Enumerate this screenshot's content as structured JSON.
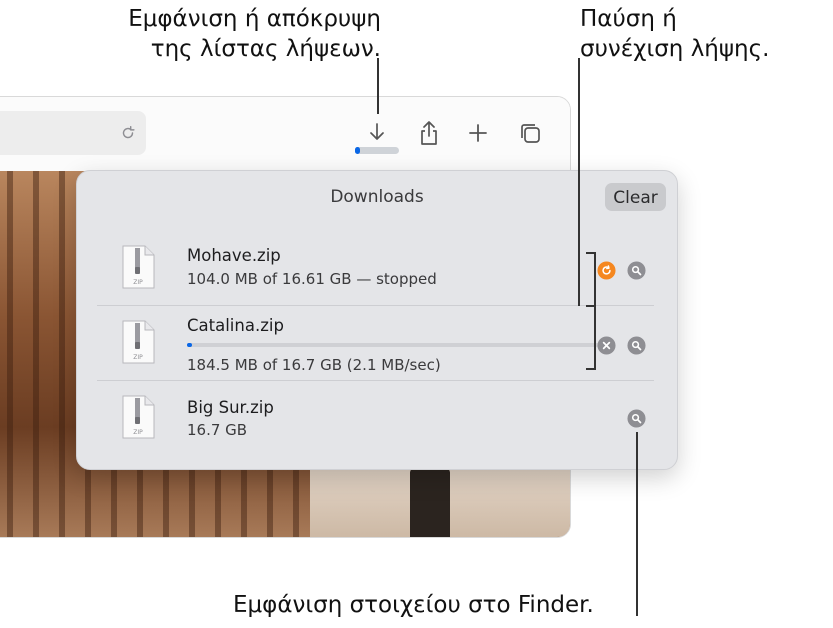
{
  "callouts": {
    "toggle_list_line1": "Εμφάνιση ή απόκρυψη",
    "toggle_list_line2": "της λίστας λήψεων.",
    "pause_resume_line1": "Παύση ή",
    "pause_resume_line2": "συνέχιση λήψης.",
    "show_in_finder": "Εμφάνιση στοιχείου στο Finder."
  },
  "toolbar": {
    "icons": [
      "reload-icon",
      "download-icon",
      "share-icon",
      "new-tab-icon",
      "tabs-overview-icon"
    ],
    "download_progress": 0.06,
    "accent": "#0a67e6"
  },
  "downloads": {
    "title": "Downloads",
    "clear_label": "Clear",
    "items": [
      {
        "name": "Mohave.zip",
        "detail": "104.0 MB of 16.61 GB — stopped",
        "icon_label": "ZIP",
        "action": "resume-icon",
        "action_color": "#f5871f",
        "progress": null
      },
      {
        "name": "Catalina.zip",
        "detail": "184.5 MB of 16.7 GB (2.1 MB/sec)",
        "icon_label": "ZIP",
        "action": "stop-icon",
        "action_color": "#8e8e93",
        "progress": 0.011
      },
      {
        "name": "Big Sur.zip",
        "detail": "16.7 GB",
        "icon_label": "ZIP",
        "action": null,
        "action_color": null,
        "progress": null
      }
    ]
  }
}
